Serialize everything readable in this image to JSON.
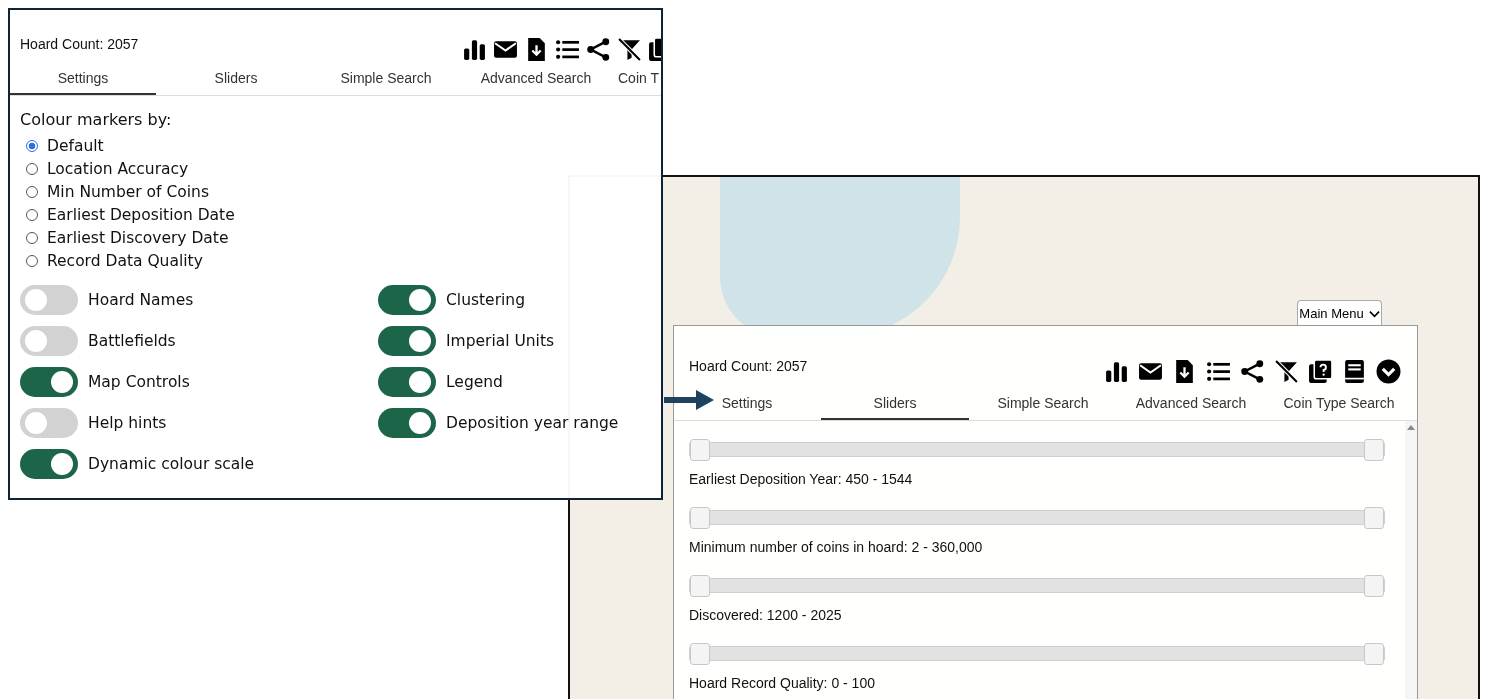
{
  "settings_panel": {
    "hoard_count": "Hoard Count: 2057",
    "tabs": [
      {
        "label": "Settings",
        "selected": true
      },
      {
        "label": "Sliders",
        "selected": false
      },
      {
        "label": "Simple Search",
        "selected": false
      },
      {
        "label": "Advanced Search",
        "selected": false
      },
      {
        "label": "Coin T",
        "selected": false
      }
    ],
    "colour_heading": "Colour markers by:",
    "colour_options": [
      {
        "label": "Default",
        "selected": true
      },
      {
        "label": "Location Accuracy",
        "selected": false
      },
      {
        "label": "Min Number of Coins",
        "selected": false
      },
      {
        "label": "Earliest Deposition Date",
        "selected": false
      },
      {
        "label": "Earliest Discovery Date",
        "selected": false
      },
      {
        "label": "Record Data Quality",
        "selected": false
      }
    ],
    "toggle_columns": [
      [
        {
          "label": "Hoard Names",
          "on": false
        },
        {
          "label": "Battlefields",
          "on": false
        },
        {
          "label": "Map Controls",
          "on": true
        },
        {
          "label": "Help hints",
          "on": false
        },
        {
          "label": "Dynamic colour scale",
          "on": true
        }
      ],
      [
        {
          "label": "Clustering",
          "on": true
        },
        {
          "label": "Imperial Units",
          "on": true
        },
        {
          "label": "Legend",
          "on": true
        },
        {
          "label": "Deposition year range",
          "on": true
        }
      ]
    ]
  },
  "map_view": {
    "main_menu": "Main Menu"
  },
  "sliders_panel": {
    "hoard_count": "Hoard Count: 2057",
    "tabs": [
      {
        "label": "Settings",
        "selected": false
      },
      {
        "label": "Sliders",
        "selected": true
      },
      {
        "label": "Simple Search",
        "selected": false
      },
      {
        "label": "Advanced Search",
        "selected": false
      },
      {
        "label": "Coin Type Search",
        "selected": false
      }
    ],
    "sliders": [
      {
        "thumbs": [
          {
            "level": 0
          },
          {
            "level": 1
          }
        ],
        "label": "Earliest Deposition Year: 450 - 1544"
      },
      {
        "thumbs": [
          {
            "level": 0
          },
          {
            "level": 1
          }
        ],
        "label": "Minimum number of coins in hoard: 2 - 360,000"
      },
      {
        "thumbs": [
          {
            "level": 0
          },
          {
            "level": 1
          }
        ],
        "label": "Discovered: 1200 - 2025"
      },
      {
        "thumbs": [
          {
            "level": 0
          },
          {
            "level": 1
          }
        ],
        "label": "Hoard Record Quality: 0 - 100"
      }
    ]
  }
}
